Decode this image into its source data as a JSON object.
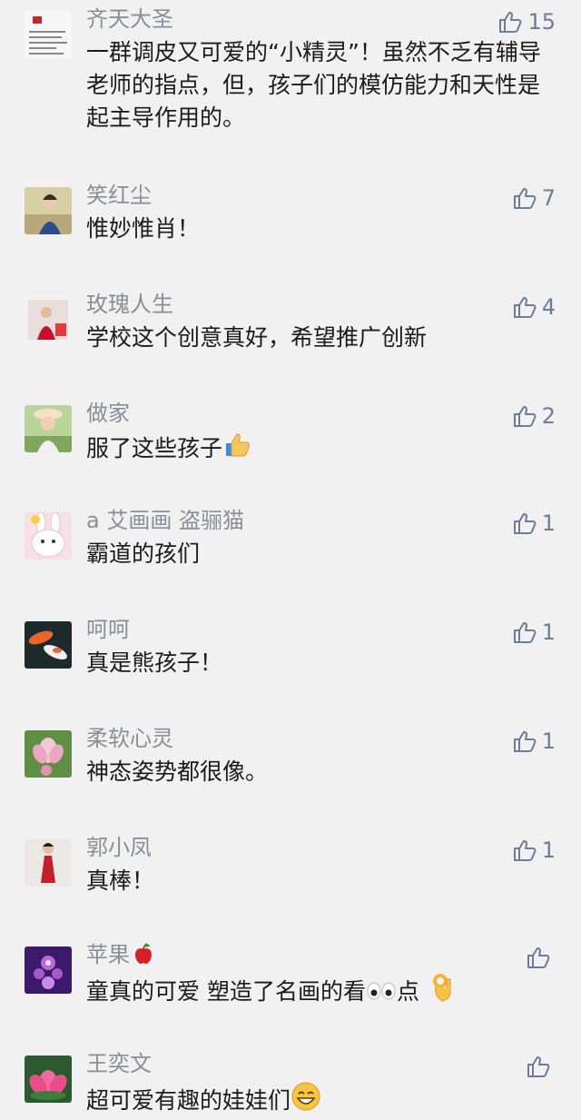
{
  "colors": {
    "background": "#f1f1f1",
    "name": "#8a8f96",
    "like": "#6c7d98",
    "text": "#1b1b1b"
  },
  "comments": [
    {
      "name": "齐天大圣",
      "text": "一群调皮又可爱的“小精灵”！虽然不乏有辅导老师的指点，但，孩子们的模仿能力和天性是起主导作用的。",
      "likes": "15",
      "avatar": "avatar-document"
    },
    {
      "name": "笑红尘",
      "text": "惟妙惟肖！",
      "likes": "7",
      "avatar": "avatar-woman-portrait"
    },
    {
      "name": "玫瑰人生",
      "text": "学校这个创意真好，希望推广创新",
      "likes": "4",
      "avatar": "avatar-woman-red"
    },
    {
      "name": "做家",
      "text": "服了这些孩子",
      "likes": "2",
      "avatar": "avatar-girl-hat"
    },
    {
      "name": "a 艾画画 盗骊猫",
      "text": "霸道的孩们",
      "likes": "1",
      "avatar": "avatar-cartoon-bunny"
    },
    {
      "name": "呵呵",
      "text": "真是熊孩子！",
      "likes": "1",
      "avatar": "avatar-koi-fish"
    },
    {
      "name": "柔软心灵",
      "text": "神态姿势都很像。",
      "likes": "1",
      "avatar": "avatar-lotus"
    },
    {
      "name": "郭小凤",
      "text": "真棒！",
      "likes": "1",
      "avatar": "avatar-woman-dress"
    },
    {
      "name": "苹果",
      "text": "童真的可爱 塑造了名画的看",
      "text2": "点",
      "likes": "",
      "avatar": "avatar-purple-flower"
    },
    {
      "name": "王奕文",
      "text": "超可爱有趣的娃娃们",
      "likes": "",
      "avatar": "avatar-pink-lotus"
    }
  ]
}
